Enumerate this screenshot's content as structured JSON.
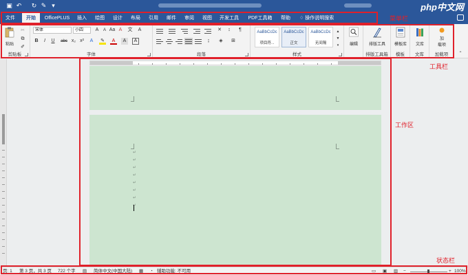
{
  "menu": {
    "tabs": [
      "文件",
      "开始",
      "OfficePLUS",
      "插入",
      "绘图",
      "设计",
      "布局",
      "引用",
      "邮件",
      "审阅",
      "视图",
      "开发工具",
      "PDF工具箱",
      "帮助"
    ],
    "active_tab": "开始",
    "help_search": "操作说明搜索"
  },
  "watermark": "php中文网",
  "ribbon": {
    "clipboard": {
      "paste_label": "粘贴",
      "group_label": "剪贴板"
    },
    "font": {
      "font_name": "宋体",
      "font_size": "小四",
      "buttons": [
        "B",
        "I",
        "U",
        "abc",
        "x₂",
        "x²",
        "A",
        "A",
        "A",
        "Aa",
        "A",
        "文"
      ],
      "group_label": "字体"
    },
    "paragraph": {
      "group_label": "段落"
    },
    "styles": {
      "items": [
        {
          "sample": "AaBbCcDc",
          "name": "项目符..."
        },
        {
          "sample": "AaBbCcDc",
          "name": "正文"
        },
        {
          "sample": "AaBbCcDc",
          "name": "无间隔"
        }
      ],
      "group_label": "样式"
    },
    "editing": {
      "label": "编辑"
    },
    "typeset": {
      "label": "排版工具",
      "group_label": "排版工具箱"
    },
    "templates": {
      "label": "模板库",
      "group_label": "模板"
    },
    "library": {
      "label": "文库",
      "group_label": "文库"
    },
    "addins": {
      "label_line1": "加",
      "label_line2": "载项",
      "group_label": "加载项"
    }
  },
  "annotations": {
    "menubar": "菜单栏",
    "toolbar": "工具栏",
    "workspace": "工作区",
    "statusbar": "状态栏"
  },
  "status": {
    "page_num": "页: 1",
    "page_of": "第 3 页，共 3 页",
    "words": "722 个字",
    "language": "简体中文(中国大陆)",
    "accessibility": "辅助功能: 不可用",
    "zoom": "100%"
  },
  "colors": {
    "title_blue": "#2b579a",
    "page_green": "#cde5d0",
    "annotation_red": "#e0202a"
  }
}
